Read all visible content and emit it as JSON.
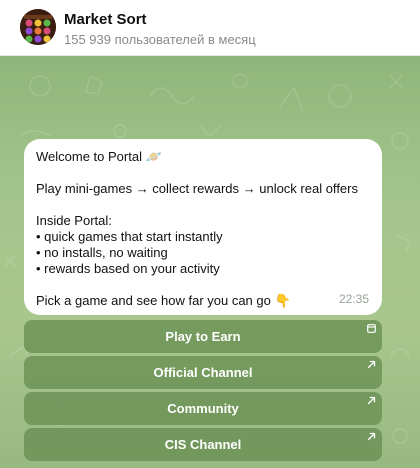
{
  "chat": {
    "title": "Market Sort",
    "subtitle": "155 939 пользователей в месяц"
  },
  "message": {
    "lines": [
      "Welcome to Portal 🪐",
      "",
      "Play mini-games → collect rewards → unlock real offers",
      "",
      "Inside Portal:",
      "• quick games that start instantly",
      "• no installs, no waiting",
      "• rewards based on your activity",
      "",
      "Pick a game and see how far you can go 👇"
    ],
    "time": "22:35"
  },
  "buttons": [
    {
      "label": "Play to Earn",
      "icon": "web-app-icon"
    },
    {
      "label": "Official Channel",
      "icon": "external-link-icon"
    },
    {
      "label": "Community",
      "icon": "external-link-icon"
    },
    {
      "label": "CIS Channel",
      "icon": "external-link-icon"
    }
  ],
  "colors": {
    "chat_background": "#a3c58b",
    "button_background": "#688e52",
    "bubble": "#ffffff"
  }
}
